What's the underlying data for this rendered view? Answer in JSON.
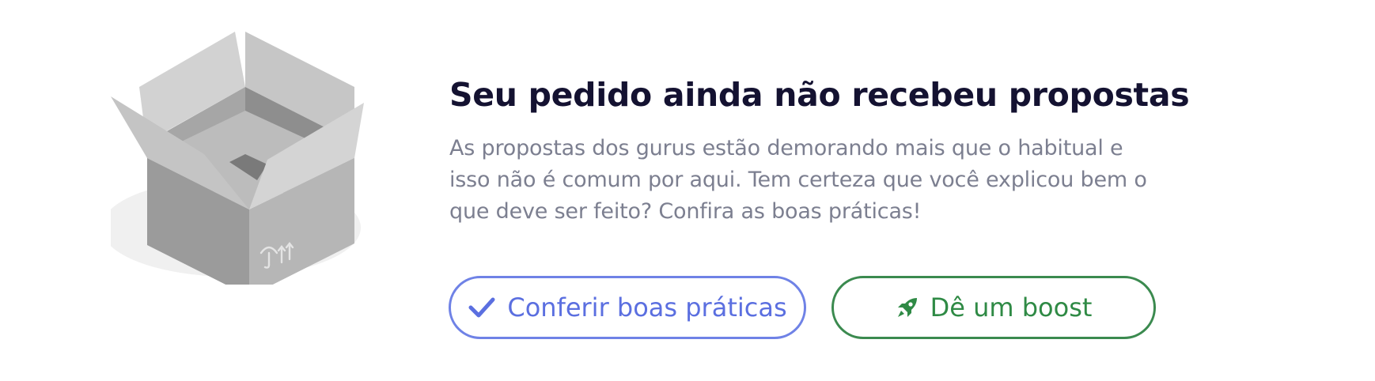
{
  "empty_state": {
    "title": "Seu pedido ainda não recebeu propostas",
    "description": "As propostas dos gurus estão demorando mais que o habitual e isso não é comum por aqui. Tem certeza que você explicou bem o que deve ser feito? Confira as boas práticas!",
    "illustration": "empty-box",
    "actions": {
      "best_practices": {
        "label": "Conferir boas práticas",
        "icon": "check-icon",
        "color": "#5b6fe0"
      },
      "boost": {
        "label": "Dê um boost",
        "icon": "rocket-icon",
        "color": "#2f8a45"
      }
    }
  }
}
